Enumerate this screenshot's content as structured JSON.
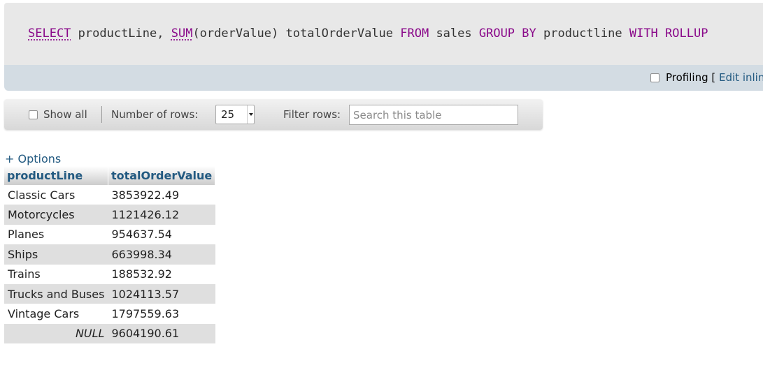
{
  "sql": {
    "tokens": {
      "select": "SELECT",
      "t1": " productLine, ",
      "sum": "SUM",
      "t2": "(orderValue) totalOrderValue ",
      "from": "FROM",
      "t3": " sales ",
      "group": "GROUP",
      "t4": " ",
      "by": "BY",
      "t5": " productline ",
      "with": "WITH",
      "t6": " ",
      "rollup": "ROLLUP"
    }
  },
  "profiling": {
    "label": "Profiling",
    "bracket": " [ ",
    "edit_inline": "Edit inline"
  },
  "nav": {
    "show_all_label": "Show all",
    "rows_label": "Number of rows:",
    "rows_value": "25",
    "filter_label": "Filter rows:",
    "filter_placeholder": "Search this table"
  },
  "options": {
    "label": "+ Options"
  },
  "table": {
    "columns": [
      "productLine",
      "totalOrderValue"
    ],
    "rows": [
      [
        "Classic Cars",
        "3853922.49"
      ],
      [
        "Motorcycles",
        "1121426.12"
      ],
      [
        "Planes",
        "954637.54"
      ],
      [
        "Ships",
        "663998.34"
      ],
      [
        "Trains",
        "188532.92"
      ],
      [
        "Trucks and Buses",
        "1024113.57"
      ],
      [
        "Vintage Cars",
        "1797559.63"
      ],
      [
        "NULL",
        "9604190.61"
      ]
    ]
  },
  "colors": {
    "keyword": "#8a0a8a",
    "link": "#235a81",
    "sql_background": "#e8e8e8",
    "profiling_background": "#d3dce3",
    "row_alt": "#dfdfdf"
  }
}
